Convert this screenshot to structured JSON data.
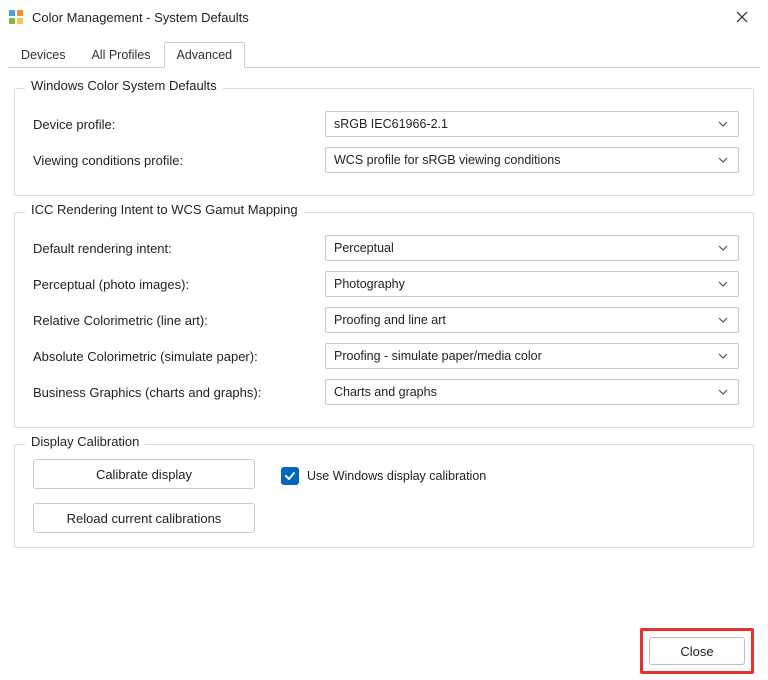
{
  "window": {
    "title": "Color Management - System Defaults"
  },
  "tabs": {
    "devices": "Devices",
    "all_profiles": "All Profiles",
    "advanced": "Advanced"
  },
  "section_wcs": {
    "legend": "Windows Color System Defaults",
    "device_profile_label": "Device profile:",
    "device_profile_value": "sRGB IEC61966-2.1",
    "viewing_cond_label": "Viewing conditions profile:",
    "viewing_cond_value": "WCS profile for sRGB viewing conditions"
  },
  "section_icc": {
    "legend": "ICC Rendering Intent to WCS Gamut Mapping",
    "default_intent_label": "Default rendering intent:",
    "default_intent_value": "Perceptual",
    "perceptual_label": "Perceptual (photo images):",
    "perceptual_value": "Photography",
    "rel_col_label": "Relative Colorimetric (line art):",
    "rel_col_value": "Proofing and line art",
    "abs_col_label": "Absolute Colorimetric (simulate paper):",
    "abs_col_value": "Proofing - simulate paper/media color",
    "business_label": "Business Graphics (charts and graphs):",
    "business_value": "Charts and graphs"
  },
  "section_calib": {
    "legend": "Display Calibration",
    "calibrate_btn": "Calibrate display",
    "reload_btn": "Reload current calibrations",
    "use_win_calib": "Use Windows display calibration",
    "use_win_calib_checked": true
  },
  "footer": {
    "close": "Close"
  }
}
